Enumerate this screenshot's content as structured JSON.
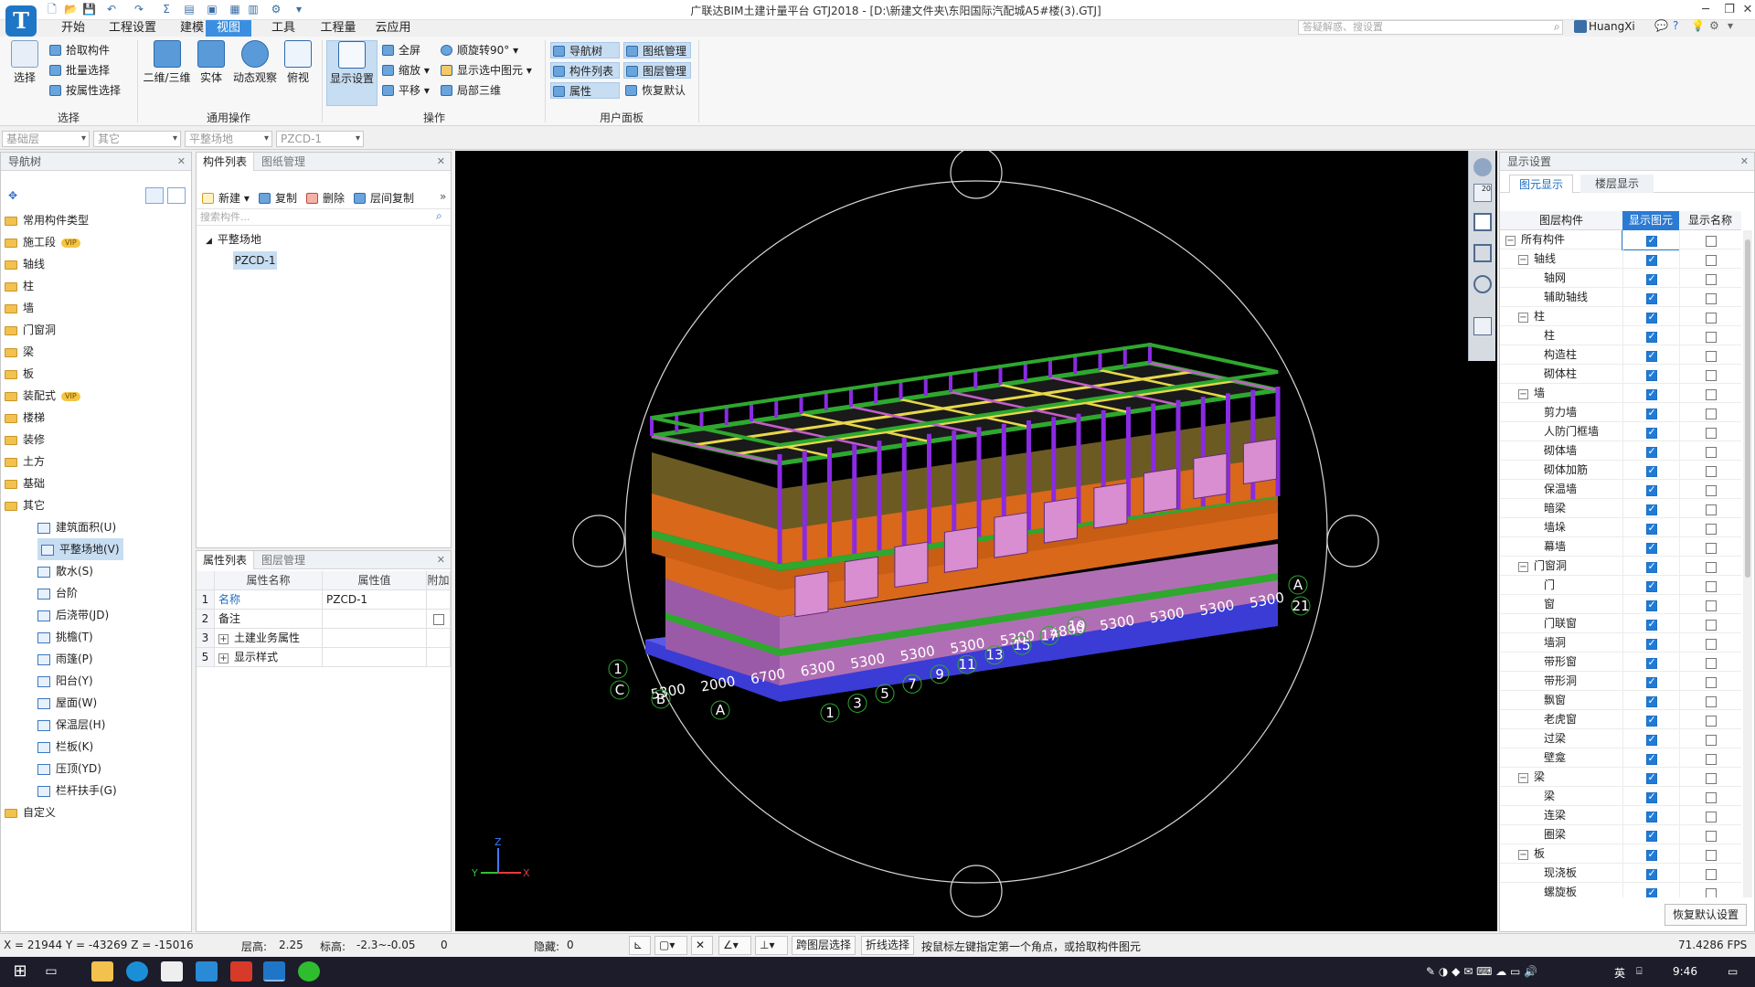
{
  "app": {
    "logo_letter": "T",
    "title": "广联达BIM土建计量平台 GTJ2018 - [D:\\新建文件夹\\东阳国际汽配城A5#楼(3).GTJ]",
    "search_placeholder": "答疑解惑、搜设置",
    "user": "HuangXi"
  },
  "menu": {
    "tabs": [
      "开始",
      "工程设置",
      "建模",
      "视图",
      "工具",
      "工程量",
      "云应用"
    ],
    "active": "视图"
  },
  "ribbon": {
    "select_group": {
      "label": "选择",
      "select": "选择",
      "pick": "拾取构件",
      "batch": "批量选择",
      "by_attr": "按属性选择"
    },
    "common_group": {
      "label": "通用操作",
      "view2d3d": "二维/三维",
      "solid": "实体",
      "dynamic": "动态观察",
      "top": "俯视"
    },
    "ops_group": {
      "label": "操作",
      "display": "显示设置",
      "fullscreen": "全屏",
      "zoom": "缩放",
      "pan": "平移",
      "rotate": "顺旋转90°",
      "show_sel": "显示选中图元",
      "local3d": "局部三维"
    },
    "panel_group": {
      "label": "用户面板",
      "nav": "导航树",
      "comp_list": "构件列表",
      "attr": "属性",
      "drawing_mgmt": "图纸管理",
      "layer_mgmt": "图层管理",
      "restore": "恢复默认"
    }
  },
  "toolbar2": {
    "floor": "基础层",
    "type": "其它",
    "category": "平整场地",
    "component": "PZCD-1"
  },
  "nav": {
    "title": "导航树",
    "items": [
      {
        "label": "常用构件类型",
        "vip": false
      },
      {
        "label": "施工段",
        "vip": true
      },
      {
        "label": "轴线",
        "vip": false
      },
      {
        "label": "柱",
        "vip": false
      },
      {
        "label": "墙",
        "vip": false
      },
      {
        "label": "门窗洞",
        "vip": false
      },
      {
        "label": "梁",
        "vip": false
      },
      {
        "label": "板",
        "vip": false
      },
      {
        "label": "装配式",
        "vip": true
      },
      {
        "label": "楼梯",
        "vip": false
      },
      {
        "label": "装修",
        "vip": false
      },
      {
        "label": "土方",
        "vip": false
      },
      {
        "label": "基础",
        "vip": false
      },
      {
        "label": "其它",
        "vip": false
      }
    ],
    "vip_text": "VIP",
    "sub_items": [
      "建筑面积(U)",
      "平整场地(V)",
      "散水(S)",
      "台阶",
      "后浇带(JD)",
      "挑檐(T)",
      "雨篷(P)",
      "阳台(Y)",
      "屋面(W)",
      "保温层(H)",
      "栏板(K)",
      "压顶(YD)",
      "栏杆扶手(G)"
    ],
    "active_sub": "平整场地(V)",
    "last": "自定义"
  },
  "comp_list": {
    "tabs": [
      "构件列表",
      "图纸管理"
    ],
    "new": "新建",
    "copy": "复制",
    "delete": "删除",
    "floor_copy": "层间复制",
    "search_placeholder": "搜索构件...",
    "tree_root": "平整场地",
    "tree_child": "PZCD-1"
  },
  "props": {
    "tabs": [
      "属性列表",
      "图层管理"
    ],
    "headers": [
      "属性名称",
      "属性值",
      "附加"
    ],
    "rows": [
      {
        "no": "1",
        "name": "名称",
        "value": "PZCD-1",
        "check": false,
        "link": true,
        "expand": false
      },
      {
        "no": "2",
        "name": "备注",
        "value": "",
        "check": true,
        "link": false,
        "expand": false
      },
      {
        "no": "3",
        "name": "土建业务属性",
        "value": "",
        "check": false,
        "link": false,
        "expand": true
      },
      {
        "no": "5",
        "name": "显示样式",
        "value": "",
        "check": false,
        "link": false,
        "expand": true
      }
    ]
  },
  "viewport": {
    "view_tool_label": "20",
    "axis_x": "X",
    "axis_y": "Y",
    "axis_z": "Z",
    "dims_front": [
      "5300",
      "2000",
      "6700",
      "6300",
      "5300",
      "5300",
      "5300",
      "5300",
      "4800",
      "5300",
      "5300",
      "5300",
      "5300"
    ],
    "grid_front": [
      "1",
      "3",
      "5",
      "7",
      "9",
      "11",
      "13",
      "15",
      "17",
      "19"
    ],
    "grid_letters_left": [
      "1",
      "C",
      "B",
      "A"
    ],
    "grid_right": [
      "A",
      "21"
    ]
  },
  "display": {
    "title": "显示设置",
    "tabs": [
      "图元显示",
      "楼层显示"
    ],
    "headers": [
      "图层构件",
      "显示图元",
      "显示名称"
    ],
    "rows": [
      {
        "label": "所有构件",
        "level": 0,
        "group": true
      },
      {
        "label": "轴线",
        "level": 1,
        "group": true
      },
      {
        "label": "轴网",
        "level": 2,
        "group": false
      },
      {
        "label": "辅助轴线",
        "level": 2,
        "group": false
      },
      {
        "label": "柱",
        "level": 1,
        "group": true
      },
      {
        "label": "柱",
        "level": 2,
        "group": false
      },
      {
        "label": "构造柱",
        "level": 2,
        "group": false
      },
      {
        "label": "砌体柱",
        "level": 2,
        "group": false
      },
      {
        "label": "墙",
        "level": 1,
        "group": true
      },
      {
        "label": "剪力墙",
        "level": 2,
        "group": false
      },
      {
        "label": "人防门框墙",
        "level": 2,
        "group": false
      },
      {
        "label": "砌体墙",
        "level": 2,
        "group": false
      },
      {
        "label": "砌体加筋",
        "level": 2,
        "group": false
      },
      {
        "label": "保温墙",
        "level": 2,
        "group": false
      },
      {
        "label": "暗梁",
        "level": 2,
        "group": false
      },
      {
        "label": "墙垛",
        "level": 2,
        "group": false
      },
      {
        "label": "幕墙",
        "level": 2,
        "group": false
      },
      {
        "label": "门窗洞",
        "level": 1,
        "group": true
      },
      {
        "label": "门",
        "level": 2,
        "group": false
      },
      {
        "label": "窗",
        "level": 2,
        "group": false
      },
      {
        "label": "门联窗",
        "level": 2,
        "group": false
      },
      {
        "label": "墙洞",
        "level": 2,
        "group": false
      },
      {
        "label": "带形窗",
        "level": 2,
        "group": false
      },
      {
        "label": "带形洞",
        "level": 2,
        "group": false
      },
      {
        "label": "飘窗",
        "level": 2,
        "group": false
      },
      {
        "label": "老虎窗",
        "level": 2,
        "group": false
      },
      {
        "label": "过梁",
        "level": 2,
        "group": false
      },
      {
        "label": "壁龛",
        "level": 2,
        "group": false
      },
      {
        "label": "梁",
        "level": 1,
        "group": true
      },
      {
        "label": "梁",
        "level": 2,
        "group": false
      },
      {
        "label": "连梁",
        "level": 2,
        "group": false
      },
      {
        "label": "圈梁",
        "level": 2,
        "group": false
      },
      {
        "label": "板",
        "level": 1,
        "group": true
      },
      {
        "label": "现浇板",
        "level": 2,
        "group": false
      },
      {
        "label": "螺旋板",
        "level": 2,
        "group": false
      }
    ],
    "restore": "恢复默认设置"
  },
  "status": {
    "coords": "X = 21944 Y = -43269 Z = -15016",
    "floor_height_label": "层高:",
    "floor_height": "2.25",
    "elevation_label": "标高:",
    "elevation": "-2.3~-0.05",
    "zero": "0",
    "hidden_label": "隐藏:",
    "hidden": "0",
    "cross_layer": "跨图层选择",
    "polyline": "折线选择",
    "hint": "按鼠标左键指定第一个角点，或拾取构件图元",
    "fps": "71.4286 FPS"
  },
  "taskbar": {
    "ime": "英",
    "time": "9:46"
  },
  "colors": {
    "accent": "#3c8fe0",
    "viewport_bg": "#000000",
    "green_frame": "#2ea82e",
    "orange_slab": "#d9681b",
    "purple_col": "#8a2be2",
    "blue_base": "#3b3bd6"
  }
}
